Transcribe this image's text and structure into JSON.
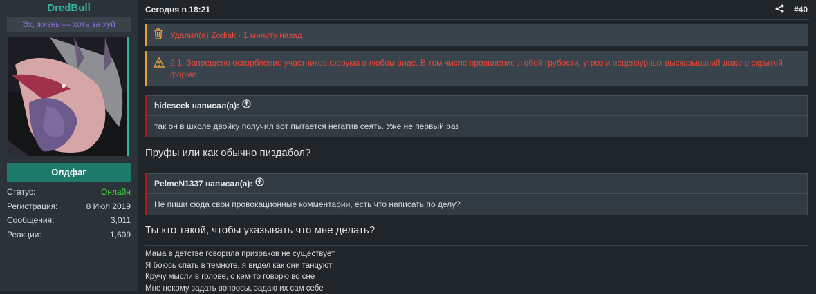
{
  "user": {
    "name": "DredBull",
    "title": "Эх, жизнь — хоть за хуй",
    "rank": "Олдфаг",
    "stats": [
      {
        "label": "Статус:",
        "value": "Онлайн"
      },
      {
        "label": "Регистрация:",
        "value": "8 Июл 2019"
      },
      {
        "label": "Сообщения:",
        "value": "3,011"
      },
      {
        "label": "Реакции:",
        "value": "1,609"
      }
    ]
  },
  "post": {
    "timestamp": "Сегодня в 18:21",
    "number": "#40",
    "deleted_notice": "Удалил(а) Zodiak · 1 минуту назад",
    "warning_notice": "2.1. Запрещено оскорбление участников форума в любом виде. В том числе проявление любой грубости, угроз и нецензурных высказываний даже в скрытой форме.",
    "quotes": [
      {
        "author": "hideseek написал(а):",
        "text": "так он в школе двойку получил вот пытается негатив сеять. Уже не первый раз"
      },
      {
        "author": "PelmeN1337 написал(а):",
        "text": "Не пиши сюда свои провокационные комментарии, есть что написать по делу?"
      }
    ],
    "replies": [
      "Пруфы или как обычно пиздабол?",
      "Ты кто такой, чтобы указывать что мне делать?"
    ],
    "signature": [
      "Мама в детстве говорила призраков не существует",
      "Я боюсь спать в темноте, я видел как они танцуют",
      "Кручу мысли в голове, с кем-то говорю во сне",
      "Мне некому задать вопросы, задаю их сам себе"
    ]
  },
  "colors": {
    "username": "#2fb39b",
    "usertitle": "#8c6be0",
    "rank_bg": "#1e7b6c",
    "online": "#44d640",
    "notice_text": "#e04a3d",
    "notice_border": "#e5a23a",
    "quote_border": "#b4121f"
  },
  "icons": {
    "deleted": "trash-icon",
    "warning": "warning-triangle-icon",
    "share": "share-icon",
    "quote_jump": "arrow-up-circle-icon"
  }
}
